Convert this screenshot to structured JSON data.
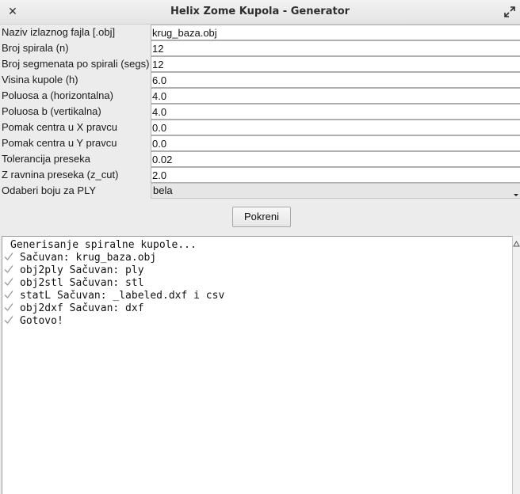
{
  "window": {
    "title": "Helix Zome Kupola - Generator",
    "close_icon": "close-icon",
    "maximize_icon": "maximize-icon"
  },
  "form": {
    "fields": [
      {
        "label": "Naziv izlaznog fajla [.obj]",
        "value": "krug_baza.obj"
      },
      {
        "label": "Broj spirala (n)",
        "value": "12"
      },
      {
        "label": "Broj segmenata po spirali (segs)",
        "value": "12"
      },
      {
        "label": "Visina kupole (h)",
        "value": "6.0"
      },
      {
        "label": "Poluosa a (horizontalna)",
        "value": "4.0"
      },
      {
        "label": "Poluosa b (vertikalna)",
        "value": "4.0"
      },
      {
        "label": "Pomak centra u X pravcu",
        "value": "0.0"
      },
      {
        "label": "Pomak centra u Y pravcu",
        "value": "0.0"
      },
      {
        "label": "Tolerancija preseka",
        "value": "0.02"
      },
      {
        "label": "Z ravnina preseka (z_cut)",
        "value": "2.0"
      }
    ],
    "color_select": {
      "label": "Odaberi boju za PLY",
      "selected": "bela"
    }
  },
  "run_button": {
    "label": "Pokreni"
  },
  "log": {
    "header": "Generisanje spiralne kupole...",
    "lines": [
      "Sačuvan: krug_baza.obj",
      "obj2ply Sačuvan: ply",
      "obj2stl Sačuvan: stl",
      "statL Sačuvan: _labeled.dxf i csv",
      "obj2dxf Sačuvan: dxf",
      "Gotovo!"
    ]
  }
}
